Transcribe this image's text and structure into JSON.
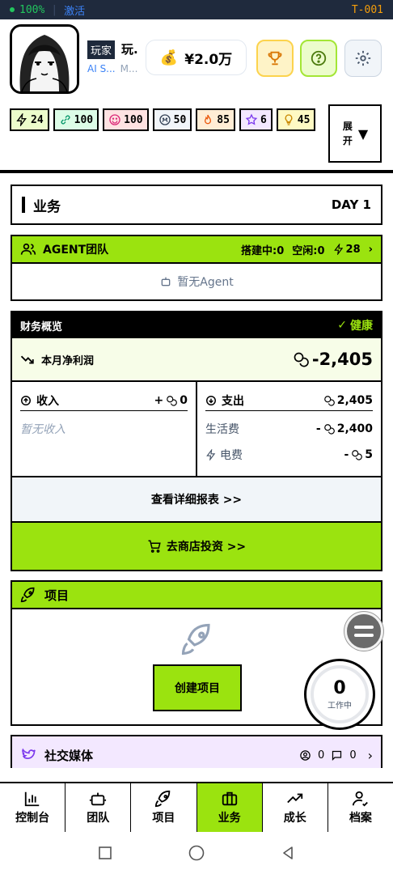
{
  "status": {
    "percent": "100%",
    "activate": "激活",
    "terminal_id": "T-001"
  },
  "header": {
    "role_tag": "玩家",
    "player_name": "玩.",
    "player_sub": "AI S...",
    "player_sub_muted": "M...",
    "money": "¥2.0万",
    "stats": [
      {
        "icon": "lightning-icon",
        "value": "24"
      },
      {
        "icon": "link-icon",
        "value": "100"
      },
      {
        "icon": "smile-icon",
        "value": "100"
      },
      {
        "icon": "frown-icon",
        "value": "50"
      },
      {
        "icon": "flame-icon",
        "value": "85"
      },
      {
        "icon": "star-icon",
        "value": "6"
      },
      {
        "icon": "bulb-icon",
        "value": "45"
      }
    ],
    "expand_label": "展开"
  },
  "business": {
    "title": "业务",
    "day": "DAY 1",
    "agent": {
      "title": "AGENT团队",
      "building": "搭建中:0",
      "idle": "空闲:0",
      "energy": "28",
      "empty": "暂无Agent"
    },
    "finance": {
      "title": "财务概览",
      "health": "健康",
      "profit_label": "本月净利润",
      "profit_value": "-2,405",
      "income_label": "收入",
      "income_value": "+",
      "income_amount": "0",
      "income_empty": "暂无收入",
      "expense_label": "支出",
      "expense_value": "2,405",
      "expenses": [
        {
          "label": "生活费",
          "sign": "-",
          "value": "2,400"
        },
        {
          "label": "电费",
          "sign": "-",
          "value": "5"
        }
      ],
      "report_button": "查看详细报表 >>",
      "shop_button": "去商店投资 >>"
    },
    "project": {
      "title": "项目",
      "create_button": "创建项目"
    },
    "social": {
      "title": "社交媒体",
      "followers": "0",
      "messages": "0"
    }
  },
  "work_badge": {
    "count": "0",
    "label": "工作中"
  },
  "nav": [
    {
      "label": "控制台",
      "icon": "chart-icon"
    },
    {
      "label": "团队",
      "icon": "robot-icon"
    },
    {
      "label": "项目",
      "icon": "rocket-icon"
    },
    {
      "label": "业务",
      "icon": "briefcase-icon",
      "active": true
    },
    {
      "label": "成长",
      "icon": "trend-icon"
    },
    {
      "label": "档案",
      "icon": "profile-icon"
    }
  ],
  "colors": {
    "accent": "#9be30f",
    "status_bg": "#1f2a3d",
    "status_green": "#22c55e",
    "status_blue": "#3b82f6",
    "status_orange": "#f59e0b"
  }
}
